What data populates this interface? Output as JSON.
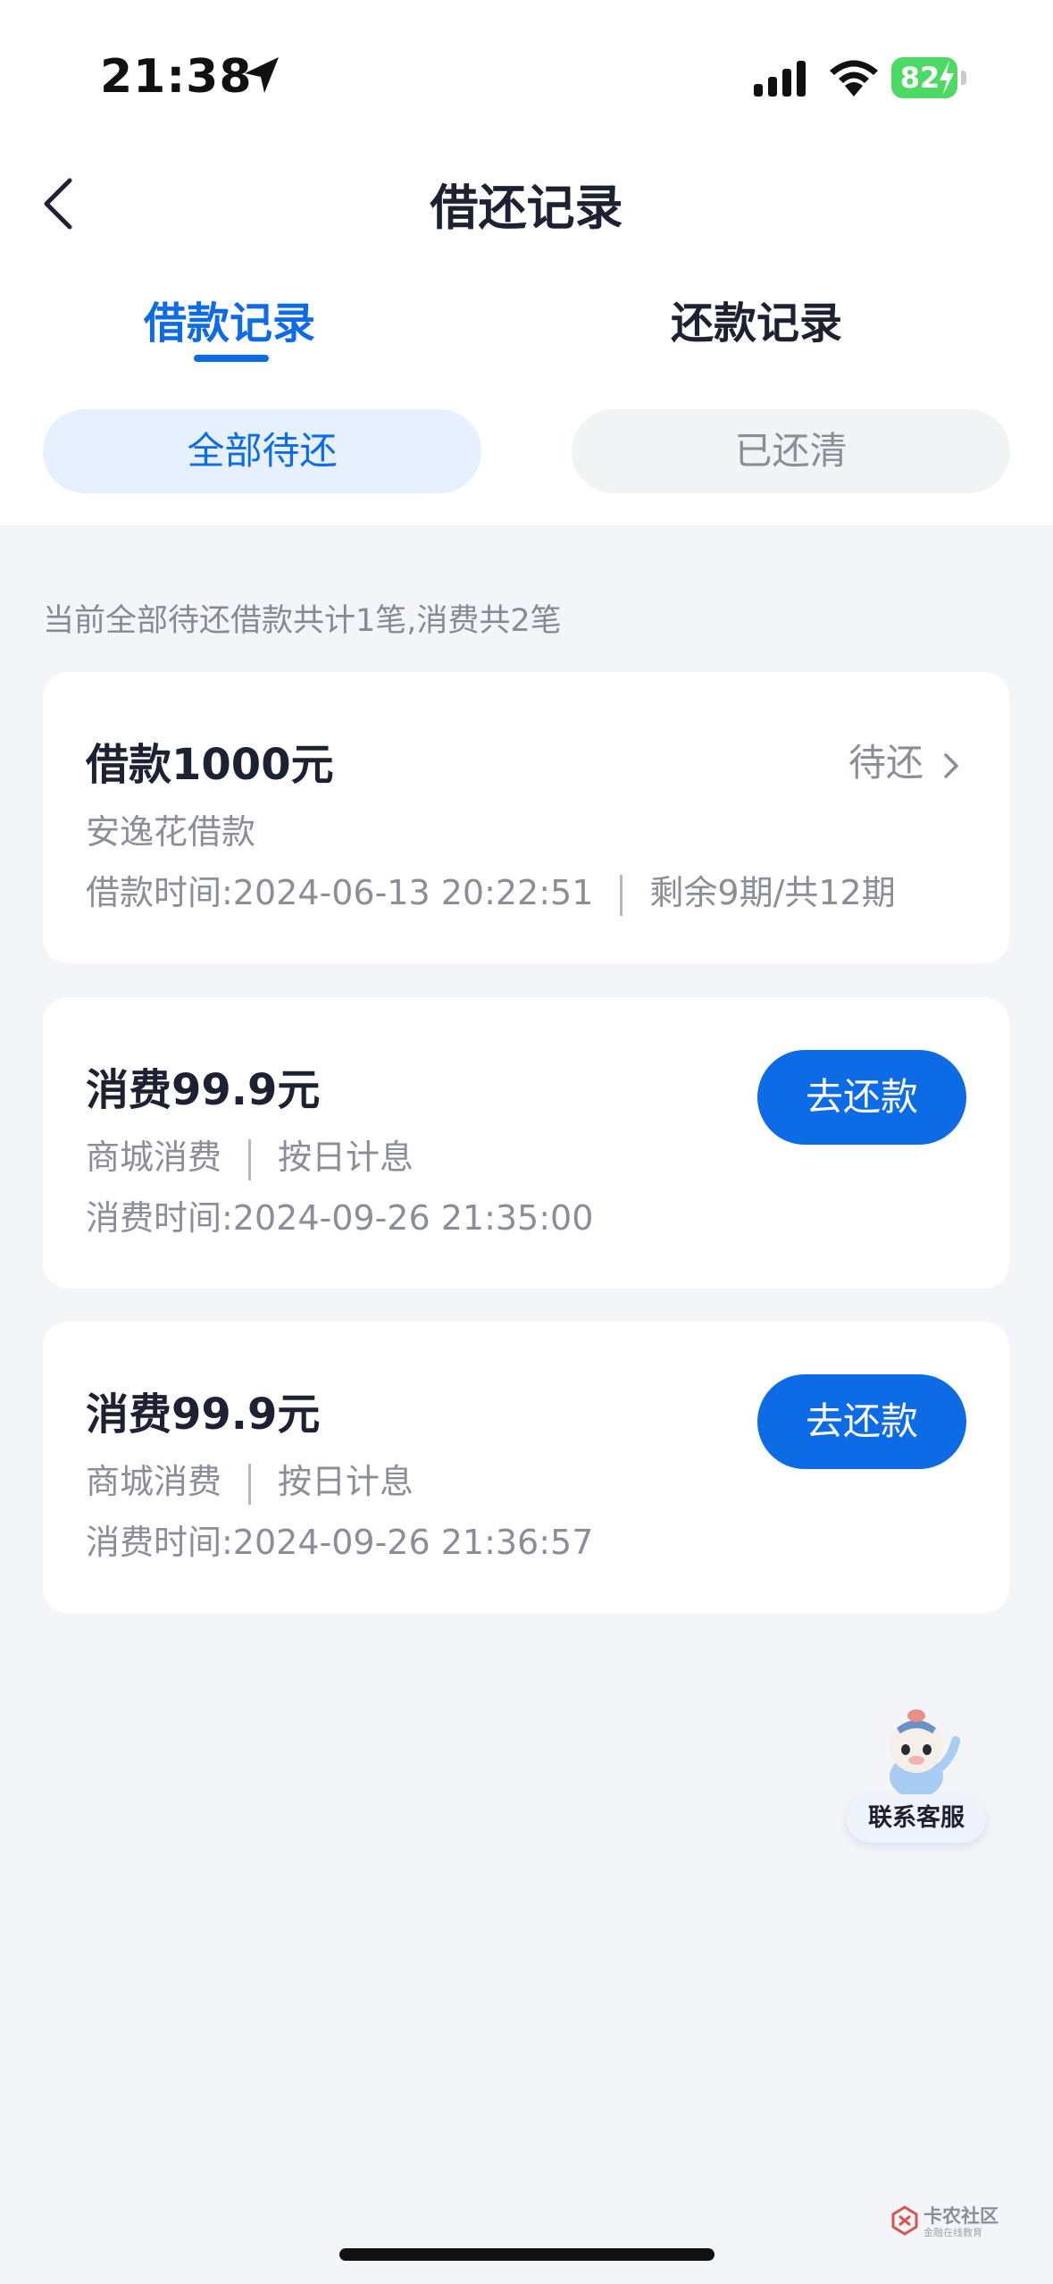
{
  "status_bar": {
    "time": "21:38",
    "battery": "82"
  },
  "header": {
    "title": "借还记录"
  },
  "tabs": [
    {
      "label": "借款记录",
      "active": true
    },
    {
      "label": "还款记录",
      "active": false
    }
  ],
  "filters": [
    {
      "label": "全部待还",
      "active": true
    },
    {
      "label": "已还清",
      "active": false
    }
  ],
  "summary": "当前全部待还借款共计1笔,消费共2笔",
  "records": [
    {
      "title": "借款1000元",
      "status": "待还",
      "line1": "安逸花借款",
      "line2_a": "借款时间:2024-06-13 20:22:51",
      "line2_b": "剩余9期/共12期"
    },
    {
      "title": "消费99.9元",
      "button": "去还款",
      "line1_a": "商城消费",
      "line1_b": "按日计息",
      "line2": "消费时间:2024-09-26 21:35:00"
    },
    {
      "title": "消费99.9元",
      "button": "去还款",
      "line1_a": "商城消费",
      "line1_b": "按日计息",
      "line2": "消费时间:2024-09-26 21:36:57"
    }
  ],
  "customer_service": {
    "label": "联系客服"
  },
  "watermark": {
    "name": "卡农社区",
    "sub": "金融在线教育"
  },
  "colors": {
    "accent": "#0d6be6",
    "background": "#f4f5f9",
    "text": "#1d2233",
    "muted": "#8a8e99"
  },
  "icons": [
    "location-arrow-icon",
    "cellular-signal-icon",
    "wifi-icon",
    "battery-icon",
    "back-chevron-icon",
    "chevron-right-icon",
    "mascot-icon"
  ]
}
